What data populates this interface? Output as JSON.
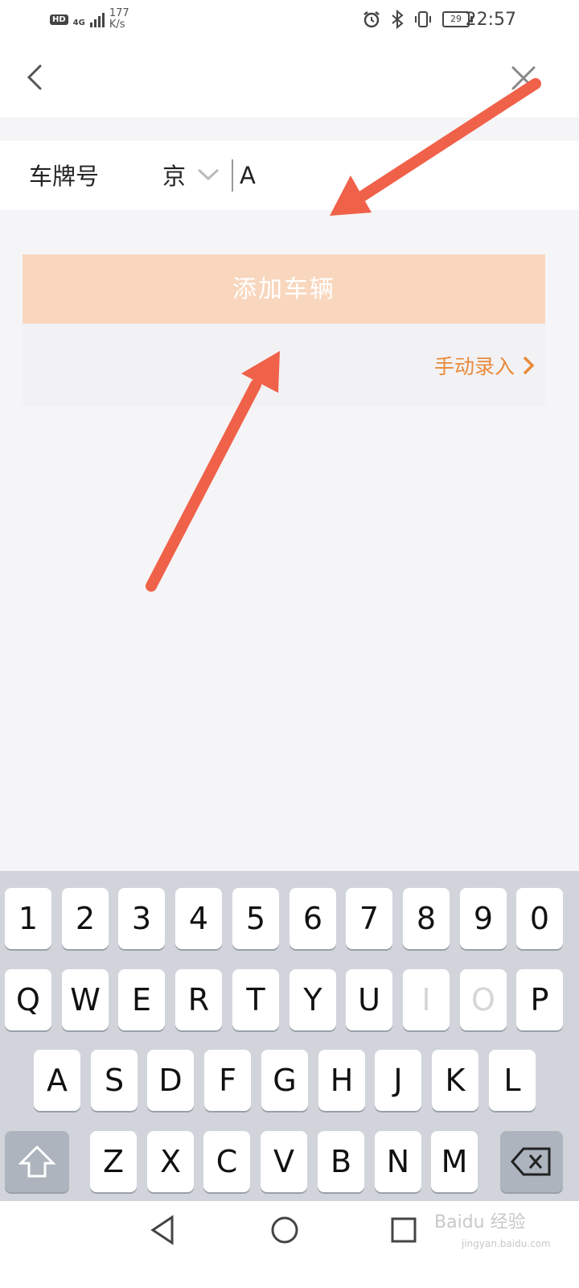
{
  "status_bar": {
    "hd": "HD",
    "network": "4G",
    "speed_value": "177",
    "speed_unit": "K/s",
    "battery": "29",
    "time": "22:57"
  },
  "form": {
    "plate_label": "车牌号",
    "province": "京",
    "plate_value": "A"
  },
  "add_button_label": "添加车辆",
  "manual_entry_label": "手动录入",
  "keyboard": {
    "row_numbers": [
      "1",
      "2",
      "3",
      "4",
      "5",
      "6",
      "7",
      "8",
      "9",
      "0"
    ],
    "row_q": [
      "Q",
      "W",
      "E",
      "R",
      "T",
      "Y",
      "U",
      "I",
      "O",
      "P"
    ],
    "row_a": [
      "A",
      "S",
      "D",
      "F",
      "G",
      "H",
      "J",
      "K",
      "L"
    ],
    "row_z": [
      "Z",
      "X",
      "C",
      "V",
      "B",
      "N",
      "M"
    ],
    "disabled_keys": [
      "I",
      "O"
    ]
  },
  "watermark": {
    "text": "Baidu 经验",
    "sub": "jingyan.baidu.com"
  },
  "colors": {
    "accent_orange": "#e98a3a",
    "button_disabled_bg": "#f8d7be",
    "annotation_arrow": "#f0614a",
    "keyboard_bg": "#d1d5db"
  }
}
